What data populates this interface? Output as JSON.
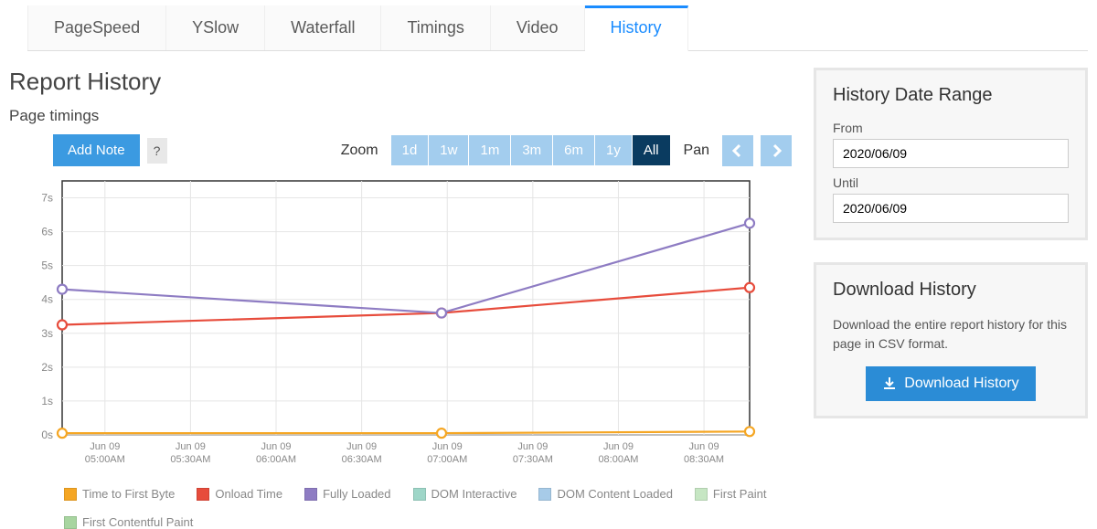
{
  "tabs": [
    "PageSpeed",
    "YSlow",
    "Waterfall",
    "Timings",
    "Video",
    "History"
  ],
  "active_tab_index": 5,
  "page_title": "Report History",
  "section_title": "Page timings",
  "toolbar": {
    "add_note": "Add Note",
    "help": "?",
    "zoom_label": "Zoom",
    "zoom_options": [
      "1d",
      "1w",
      "1m",
      "3m",
      "6m",
      "1y",
      "All"
    ],
    "zoom_active_index": 6,
    "pan_label": "Pan"
  },
  "panels": {
    "date_range": {
      "title": "History Date Range",
      "from_label": "From",
      "from_value": "2020/06/09",
      "until_label": "Until",
      "until_value": "2020/06/09"
    },
    "download": {
      "title": "Download History",
      "text": "Download the entire report history for this page in CSV format.",
      "button": "Download History"
    }
  },
  "chart_data": {
    "type": "line",
    "title": "",
    "xlabel": "",
    "ylabel": "",
    "ylim": [
      0,
      7.5
    ],
    "y_unit": "s",
    "x_tick_labels": [
      "Jun 09\n05:00AM",
      "Jun 09\n05:30AM",
      "Jun 09\n06:00AM",
      "Jun 09\n06:30AM",
      "Jun 09\n07:00AM",
      "Jun 09\n07:30AM",
      "Jun 09\n08:00AM",
      "Jun 09\n08:30AM"
    ],
    "x_values_minutes": [
      285,
      418,
      526
    ],
    "series": [
      {
        "name": "Time to First Byte",
        "color": "#f5a623",
        "values": [
          0.05,
          0.05,
          0.1
        ]
      },
      {
        "name": "Onload Time",
        "color": "#e74c3c",
        "values": [
          3.25,
          3.6,
          4.35
        ]
      },
      {
        "name": "Fully Loaded",
        "color": "#8e7cc3",
        "values": [
          4.3,
          3.6,
          6.25
        ]
      },
      {
        "name": "DOM Interactive",
        "color": "#9ed6c8",
        "values": [
          null,
          null,
          null
        ]
      },
      {
        "name": "DOM Content Loaded",
        "color": "#a7cbe8",
        "values": [
          null,
          null,
          null
        ]
      },
      {
        "name": "First Paint",
        "color": "#c6e6c3",
        "values": [
          null,
          null,
          null
        ]
      },
      {
        "name": "First Contentful Paint",
        "color": "#a8d5a0",
        "values": [
          null,
          null,
          null
        ]
      }
    ]
  }
}
